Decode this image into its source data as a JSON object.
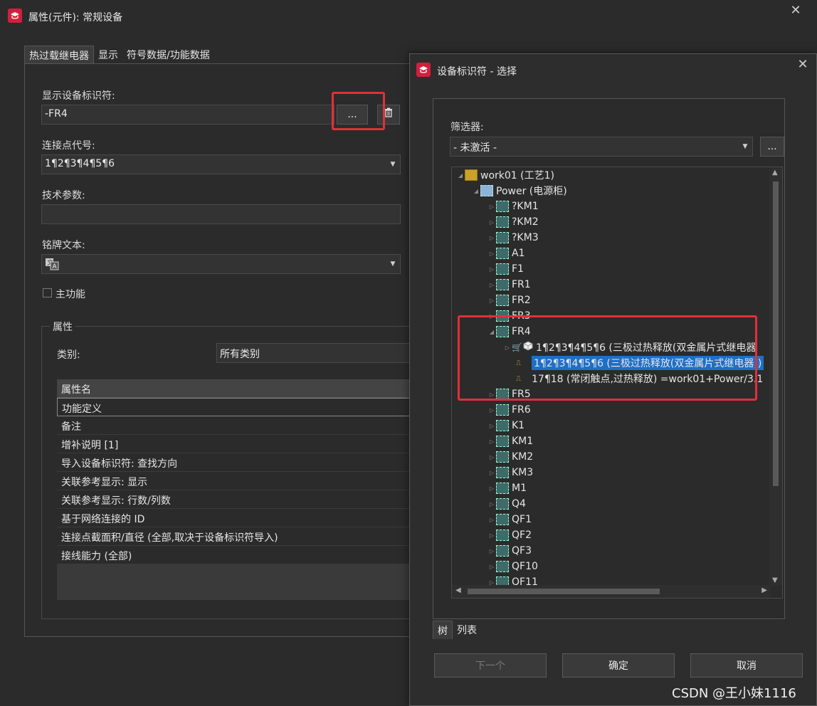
{
  "main_window": {
    "title": "属性(元件): 常规设备",
    "tabs": [
      "热过载继电器",
      "显示",
      "符号数据/功能数据"
    ],
    "dt_label": "显示设备标识符:",
    "dt_value": "-FR4",
    "browse_label": "...",
    "connection_label": "连接点代号:",
    "connection_value": "1¶2¶3¶4¶5¶6",
    "tech_label": "技术参数:",
    "tech_value": "",
    "nameplate_label": "铭牌文本:",
    "main_function_label": "主功能",
    "properties_group": "属性",
    "category_label": "类别:",
    "category_value": "所有类别",
    "grid_header": "属性名",
    "grid_rows": [
      "功能定义",
      "备注",
      "增补说明 [1]",
      "导入设备标识符: 查找方向",
      "关联参考显示: 显示",
      "关联参考显示: 行数/列数",
      "基于网络连接的 ID",
      "连接点截面积/直径 (全部,取决于设备标识符导入)",
      "接线能力 (全部)"
    ]
  },
  "dialog": {
    "title": "设备标识符 - 选择",
    "filter_label": "筛选器:",
    "filter_value": "- 未激活 -",
    "filter_btn": "...",
    "tree": {
      "root": "work01 (工艺1)",
      "location": "Power (电源柜)",
      "devices_before": [
        "?KM1",
        "?KM2",
        "?KM3",
        "A1",
        "F1",
        "FR1",
        "FR2",
        "FR3"
      ],
      "expanded": "FR4",
      "children": [
        "1¶2¶3¶4¶5¶6 (三极过热释放(双金属片式继电器",
        "1¶2¶3¶4¶5¶6 (三极过热释放(双金属片式继电器))",
        "17¶18 (常闭触点,过热释放) =work01+Power/3.1"
      ],
      "devices_after": [
        "FR5",
        "FR6",
        "K1",
        "KM1",
        "KM2",
        "KM3",
        "M1",
        "Q4",
        "QF1",
        "QF2",
        "QF3",
        "QF10",
        "QF11"
      ]
    },
    "view_tabs": [
      "树",
      "列表"
    ],
    "buttons": {
      "next": "下一个",
      "ok": "确定",
      "cancel": "取消"
    }
  },
  "watermark": "CSDN @王小妹1116",
  "colors": {
    "accent_red": "#e0303a",
    "selection": "#1e6fc7",
    "app_icon": "#d21f3c"
  }
}
